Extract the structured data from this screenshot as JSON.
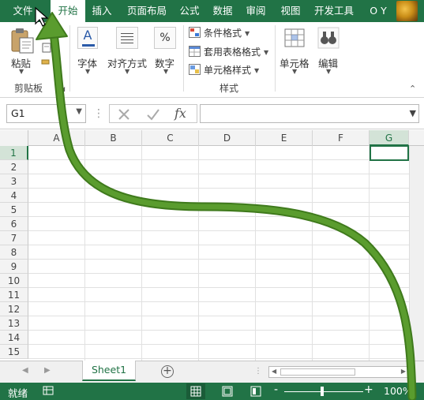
{
  "colors": {
    "accent": "#217346",
    "arrow": "#5a9c2e",
    "arrow_edge": "#3f7a1c"
  },
  "tabs": [
    {
      "id": "file",
      "label": "文件"
    },
    {
      "id": "home",
      "label": "开始"
    },
    {
      "id": "insert",
      "label": "插入"
    },
    {
      "id": "layout",
      "label": "页面布局"
    },
    {
      "id": "formula",
      "label": "公式"
    },
    {
      "id": "data",
      "label": "数据"
    },
    {
      "id": "review",
      "label": "审阅"
    },
    {
      "id": "view",
      "label": "视图"
    },
    {
      "id": "dev",
      "label": "开发工具"
    },
    {
      "id": "user",
      "label": "O Y"
    }
  ],
  "active_tab": "开始",
  "ribbon": {
    "clipboard": {
      "paste_label": "粘贴",
      "group_label": "剪贴板"
    },
    "font": {
      "label": "字体"
    },
    "alignment": {
      "label": "对齐方式"
    },
    "number": {
      "label": "数字"
    },
    "styles": {
      "conditional_label": "条件格式",
      "table_label": "套用表格格式",
      "cell_styles_label": "单元格样式",
      "group_label": "样式"
    },
    "cells": {
      "label": "单元格"
    },
    "editing": {
      "label": "编辑"
    },
    "font_icon": "A",
    "number_icon": "%"
  },
  "formula_bar": {
    "name_box": "G1",
    "fx": "fx",
    "formula": ""
  },
  "columns": [
    "A",
    "B",
    "C",
    "D",
    "E",
    "F",
    "G"
  ],
  "selected_column": "G",
  "rows": [
    "1",
    "2",
    "3",
    "4",
    "5",
    "6",
    "7",
    "8",
    "9",
    "10",
    "11",
    "12",
    "13",
    "14",
    "15"
  ],
  "selected_row": "1",
  "sheets": [
    {
      "label": "Sheet1"
    }
  ],
  "add_sheet": "+",
  "status": {
    "ready": "就绪",
    "zoom": "100%",
    "zoom_minus": "-",
    "zoom_plus": "+"
  }
}
